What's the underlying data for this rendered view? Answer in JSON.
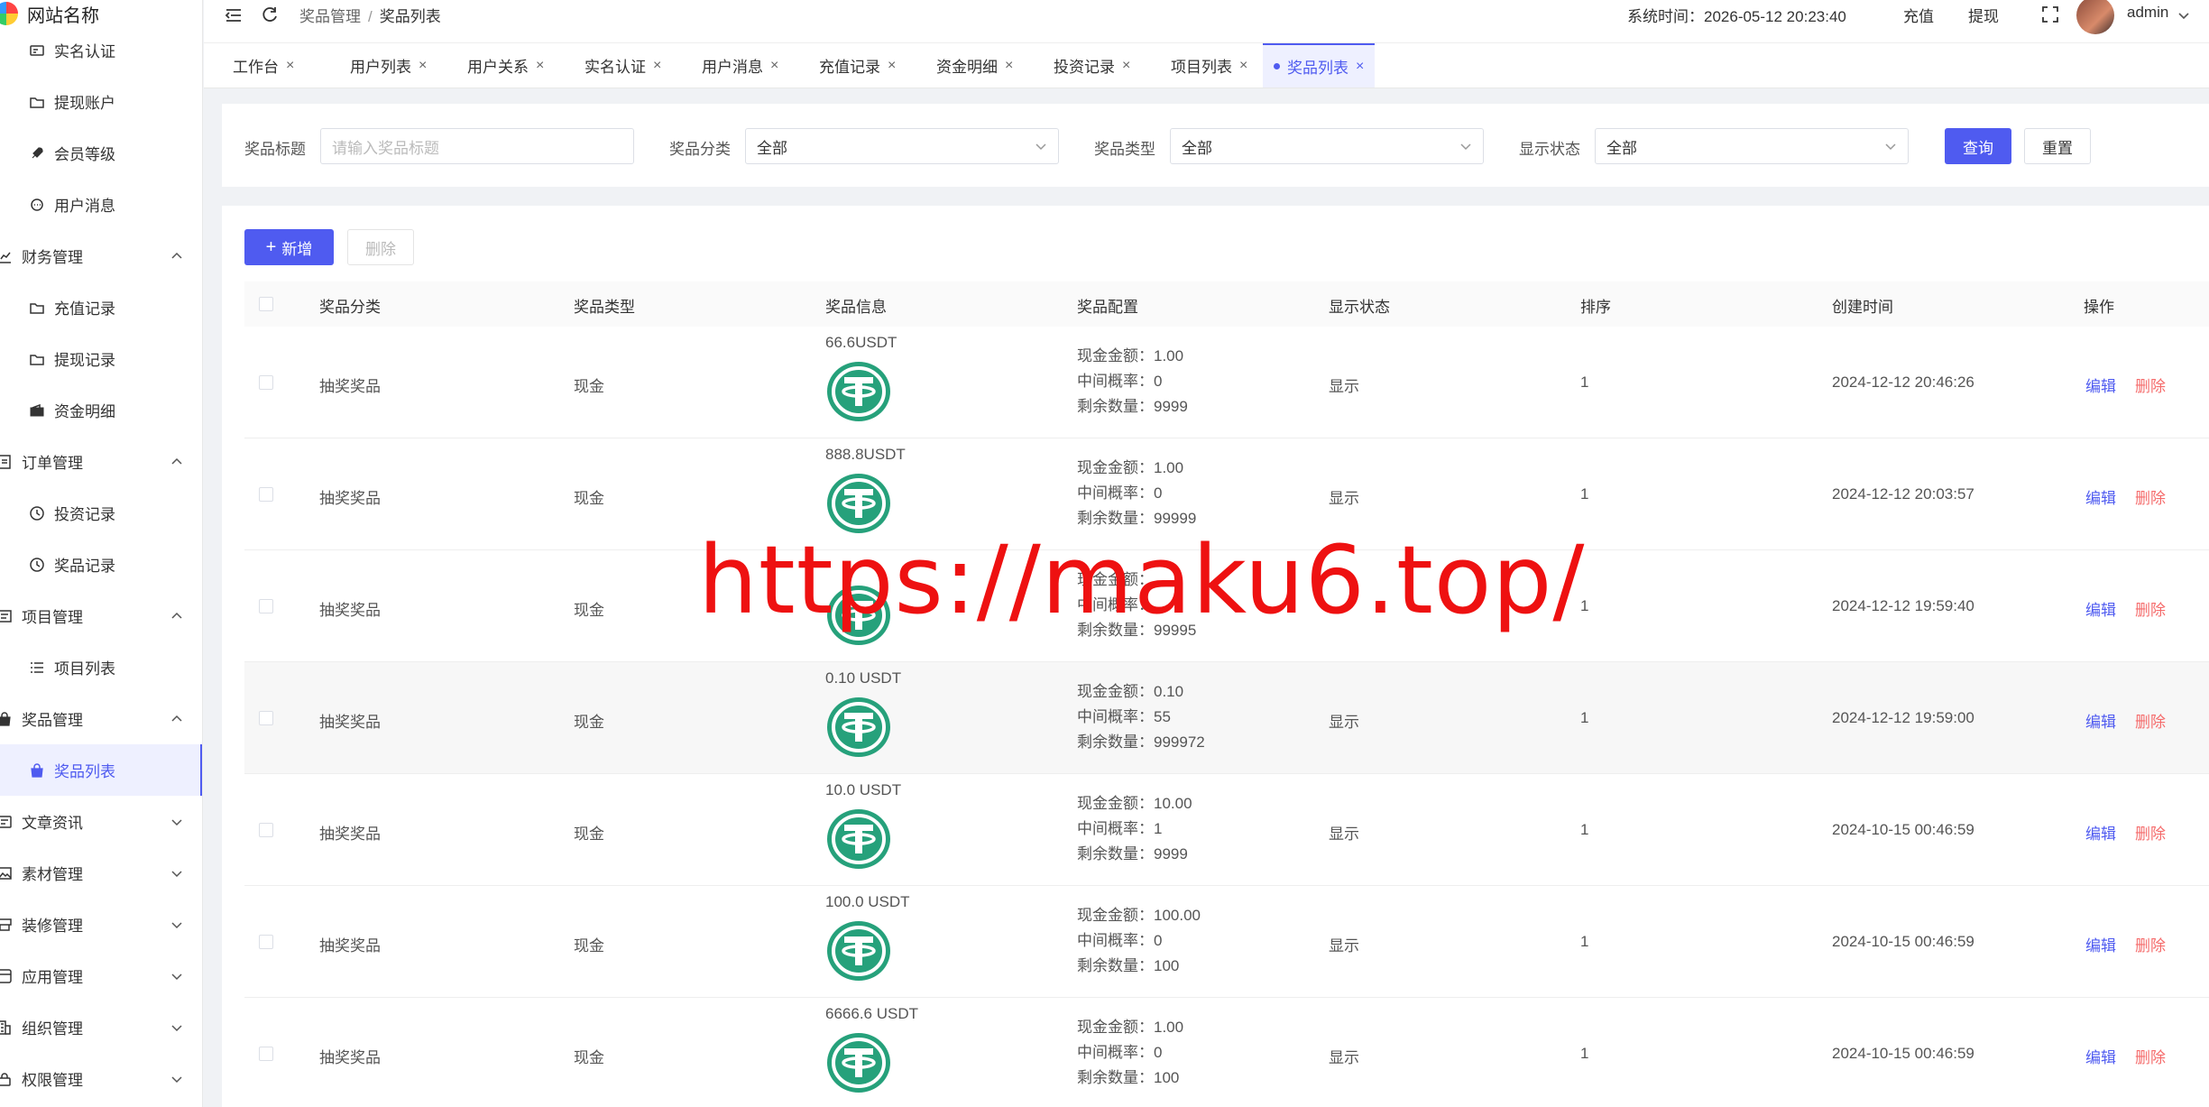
{
  "app": {
    "site_name": "网站名称"
  },
  "sidebar": {
    "items": [
      {
        "label": "实名认证",
        "icon": "id-card-icon",
        "type": "sub"
      },
      {
        "label": "提现账户",
        "icon": "folder-icon",
        "type": "sub"
      },
      {
        "label": "会员等级",
        "icon": "rocket-icon",
        "type": "sub"
      },
      {
        "label": "用户消息",
        "icon": "chat-icon",
        "type": "sub"
      },
      {
        "label": "财务管理",
        "icon": "chart-icon",
        "type": "group",
        "expanded": true
      },
      {
        "label": "充值记录",
        "icon": "folder-icon",
        "type": "sub"
      },
      {
        "label": "提现记录",
        "icon": "folder-icon",
        "type": "sub"
      },
      {
        "label": "资金明细",
        "icon": "wallet-icon",
        "type": "sub"
      },
      {
        "label": "订单管理",
        "icon": "document-icon",
        "type": "group",
        "expanded": true
      },
      {
        "label": "投资记录",
        "icon": "clock-icon",
        "type": "sub"
      },
      {
        "label": "奖品记录",
        "icon": "clock-icon",
        "type": "sub"
      },
      {
        "label": "项目管理",
        "icon": "project-icon",
        "type": "group",
        "expanded": true
      },
      {
        "label": "项目列表",
        "icon": "list-icon",
        "type": "sub"
      },
      {
        "label": "奖品管理",
        "icon": "bag-icon",
        "type": "group",
        "expanded": true
      },
      {
        "label": "奖品列表",
        "icon": "bag-icon",
        "type": "sub",
        "active": true
      },
      {
        "label": "文章资讯",
        "icon": "article-icon",
        "type": "group",
        "expanded": false
      },
      {
        "label": "素材管理",
        "icon": "image-icon",
        "type": "group",
        "expanded": false
      },
      {
        "label": "装修管理",
        "icon": "decor-icon",
        "type": "group",
        "expanded": false
      },
      {
        "label": "应用管理",
        "icon": "app-icon",
        "type": "group",
        "expanded": false
      },
      {
        "label": "组织管理",
        "icon": "org-icon",
        "type": "group",
        "expanded": false
      },
      {
        "label": "权限管理",
        "icon": "lock-icon",
        "type": "group",
        "expanded": false
      }
    ]
  },
  "header": {
    "breadcrumb": [
      "奖品管理",
      "奖品列表"
    ],
    "breadcrumb_sep": "/",
    "system_time": "系统时间：2026-05-12 20:23:40",
    "recharge": "充值",
    "withdraw": "提现",
    "user": "admin"
  },
  "tabs": [
    {
      "label": "工作台"
    },
    {
      "label": "用户列表"
    },
    {
      "label": "用户关系"
    },
    {
      "label": "实名认证"
    },
    {
      "label": "用户消息"
    },
    {
      "label": "充值记录"
    },
    {
      "label": "资金明细"
    },
    {
      "label": "投资记录"
    },
    {
      "label": "项目列表"
    },
    {
      "label": "奖品列表",
      "active": true
    }
  ],
  "filters": {
    "title_label": "奖品标题",
    "title_placeholder": "请输入奖品标题",
    "category_label": "奖品分类",
    "category_value": "全部",
    "type_label": "奖品类型",
    "type_value": "全部",
    "status_label": "显示状态",
    "status_value": "全部",
    "query": "查询",
    "reset": "重置"
  },
  "toolbar": {
    "add": "新增",
    "delete": "删除"
  },
  "table": {
    "columns": [
      "奖品分类",
      "奖品类型",
      "奖品信息",
      "奖品配置",
      "显示状态",
      "排序",
      "创建时间",
      "操作"
    ],
    "cfg_labels": {
      "amount": "现金金额：",
      "prob": "中间概率：",
      "remain": "剩余数量："
    },
    "actions": {
      "edit": "编辑",
      "delete": "删除"
    },
    "rows": [
      {
        "category": "抽奖奖品",
        "type": "现金",
        "info": "66.6USDT",
        "amount": "1.00",
        "prob": "0",
        "remain": "9999",
        "status": "显示",
        "sort": "1",
        "created": "2024-12-12 20:46:26"
      },
      {
        "category": "抽奖奖品",
        "type": "现金",
        "info": "888.8USDT",
        "amount": "1.00",
        "prob": "0",
        "remain": "99999",
        "status": "显示",
        "sort": "1",
        "created": "2024-12-12 20:03:57"
      },
      {
        "category": "抽奖奖品",
        "type": "现金",
        "info": "",
        "amount": "",
        "prob": "",
        "remain": "99995",
        "status": "",
        "sort": "1",
        "created": "2024-12-12 19:59:40"
      },
      {
        "category": "抽奖奖品",
        "type": "现金",
        "info": "0.10 USDT",
        "amount": "0.10",
        "prob": "55",
        "remain": "999972",
        "status": "显示",
        "sort": "1",
        "created": "2024-12-12 19:59:00"
      },
      {
        "category": "抽奖奖品",
        "type": "现金",
        "info": "10.0 USDT",
        "amount": "10.00",
        "prob": "1",
        "remain": "9999",
        "status": "显示",
        "sort": "1",
        "created": "2024-10-15 00:46:59"
      },
      {
        "category": "抽奖奖品",
        "type": "现金",
        "info": "100.0 USDT",
        "amount": "100.00",
        "prob": "0",
        "remain": "100",
        "status": "显示",
        "sort": "1",
        "created": "2024-10-15 00:46:59"
      },
      {
        "category": "抽奖奖品",
        "type": "现金",
        "info": "6666.6 USDT",
        "amount": "1.00",
        "prob": "0",
        "remain": "100",
        "status": "显示",
        "sort": "1",
        "created": "2024-10-15 00:46:59"
      }
    ]
  },
  "watermark": "https://maku6.top/",
  "colors": {
    "primary": "#4f5bf0",
    "danger": "#f56c6c",
    "usdt": "#26a17b",
    "watermark": "#e11111"
  }
}
